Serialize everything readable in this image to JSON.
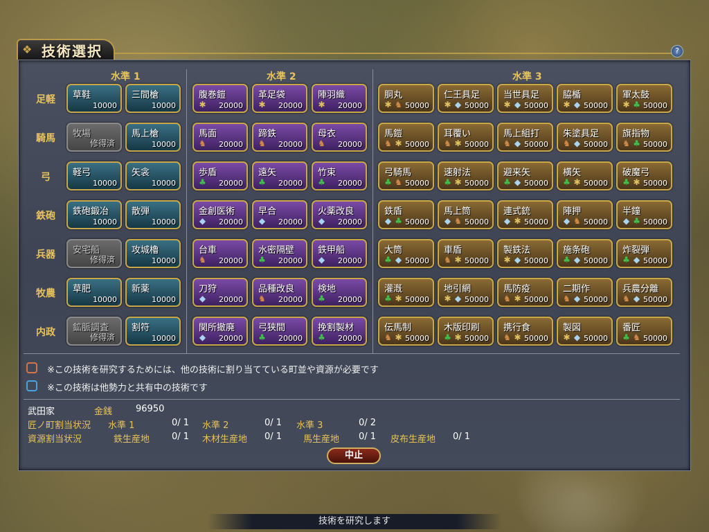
{
  "title": "技術選択",
  "help_label": "?",
  "levels": [
    "水準 1",
    "水準 2",
    "水準 3"
  ],
  "rows": [
    "足軽",
    "騎馬",
    "弓",
    "鉄砲",
    "兵器",
    "牧農",
    "内政"
  ],
  "lvl1": [
    [
      {
        "n": "草鞋",
        "c": "10000"
      },
      {
        "n": "三間槍",
        "c": "10000"
      }
    ],
    [
      {
        "n": "牧場",
        "c": "修得済",
        "g": true
      },
      {
        "n": "馬上槍",
        "c": "10000"
      }
    ],
    [
      {
        "n": "軽弓",
        "c": "10000"
      },
      {
        "n": "矢衾",
        "c": "10000"
      }
    ],
    [
      {
        "n": "鉄砲鍛冶",
        "c": "10000"
      },
      {
        "n": "散弾",
        "c": "10000"
      }
    ],
    [
      {
        "n": "安宅船",
        "c": "修得済",
        "g": true
      },
      {
        "n": "攻城櫓",
        "c": "10000"
      }
    ],
    [
      {
        "n": "草肥",
        "c": "10000"
      },
      {
        "n": "新薬",
        "c": "10000"
      }
    ],
    [
      {
        "n": "鉱脈調査",
        "c": "修得済",
        "g": true
      },
      {
        "n": "割符",
        "c": "10000"
      }
    ]
  ],
  "lvl2": [
    [
      {
        "n": "腹巻鎧",
        "c": "20000",
        "i": [
          "cloth"
        ]
      },
      {
        "n": "革足袋",
        "c": "20000",
        "i": [
          "cloth"
        ]
      },
      {
        "n": "陣羽織",
        "c": "20000",
        "i": [
          "cloth"
        ]
      }
    ],
    [
      {
        "n": "馬面",
        "c": "20000",
        "i": [
          "horse"
        ]
      },
      {
        "n": "蹄鉄",
        "c": "20000",
        "i": [
          "horse"
        ]
      },
      {
        "n": "母衣",
        "c": "20000",
        "i": [
          "horse"
        ]
      }
    ],
    [
      {
        "n": "歩盾",
        "c": "20000",
        "i": [
          "wood"
        ]
      },
      {
        "n": "遠矢",
        "c": "20000",
        "i": [
          "wood"
        ]
      },
      {
        "n": "竹束",
        "c": "20000",
        "i": [
          "wood"
        ]
      }
    ],
    [
      {
        "n": "金創医術",
        "c": "20000",
        "i": [
          "iron"
        ]
      },
      {
        "n": "早合",
        "c": "20000",
        "i": [
          "iron"
        ]
      },
      {
        "n": "火薬改良",
        "c": "20000",
        "i": [
          "iron"
        ]
      }
    ],
    [
      {
        "n": "台車",
        "c": "20000",
        "i": [
          "horse"
        ]
      },
      {
        "n": "水密隔壁",
        "c": "20000",
        "i": [
          "wood"
        ]
      },
      {
        "n": "鉄甲船",
        "c": "20000",
        "i": [
          "iron"
        ]
      }
    ],
    [
      {
        "n": "刀狩",
        "c": "20000",
        "i": [
          "iron"
        ]
      },
      {
        "n": "品種改良",
        "c": "20000",
        "i": [
          "horse"
        ]
      },
      {
        "n": "検地",
        "c": "20000",
        "i": [
          "wood"
        ]
      }
    ],
    [
      {
        "n": "関所撤廃",
        "c": "20000",
        "i": [
          "iron"
        ]
      },
      {
        "n": "弓狭間",
        "c": "20000",
        "i": [
          "wood"
        ]
      },
      {
        "n": "挽割製材",
        "c": "20000",
        "i": [
          "wood"
        ]
      }
    ]
  ],
  "lvl3": [
    [
      {
        "n": "胴丸",
        "c": "50000",
        "i": [
          "cloth",
          "horse"
        ]
      },
      {
        "n": "仁王具足",
        "c": "50000",
        "i": [
          "cloth",
          "iron"
        ]
      },
      {
        "n": "当世具足",
        "c": "50000",
        "i": [
          "cloth",
          "iron"
        ]
      },
      {
        "n": "脇楯",
        "c": "50000",
        "i": [
          "cloth",
          "iron"
        ]
      },
      {
        "n": "軍太鼓",
        "c": "50000",
        "i": [
          "cloth",
          "wood"
        ]
      }
    ],
    [
      {
        "n": "馬鎧",
        "c": "50000",
        "i": [
          "horse",
          "cloth"
        ]
      },
      {
        "n": "耳覆い",
        "c": "50000",
        "i": [
          "horse",
          "cloth"
        ]
      },
      {
        "n": "馬上組打",
        "c": "50000",
        "i": [
          "horse",
          "iron"
        ]
      },
      {
        "n": "朱塗具足",
        "c": "50000",
        "i": [
          "horse",
          "iron"
        ]
      },
      {
        "n": "旗指物",
        "c": "50000",
        "i": [
          "horse",
          "wood"
        ]
      }
    ],
    [
      {
        "n": "弓騎馬",
        "c": "50000",
        "i": [
          "wood",
          "horse"
        ]
      },
      {
        "n": "速射法",
        "c": "50000",
        "i": [
          "wood",
          "cloth"
        ]
      },
      {
        "n": "避来矢",
        "c": "50000",
        "i": [
          "wood",
          "iron"
        ]
      },
      {
        "n": "横矢",
        "c": "50000",
        "i": [
          "wood",
          "cloth"
        ]
      },
      {
        "n": "破魔弓",
        "c": "50000",
        "i": [
          "wood",
          "cloth"
        ]
      }
    ],
    [
      {
        "n": "鉄盾",
        "c": "50000",
        "i": [
          "iron",
          "wood"
        ]
      },
      {
        "n": "馬上筒",
        "c": "50000",
        "i": [
          "iron",
          "horse"
        ]
      },
      {
        "n": "連式銃",
        "c": "50000",
        "i": [
          "iron",
          "cloth"
        ]
      },
      {
        "n": "陣押",
        "c": "50000",
        "i": [
          "iron",
          "horse"
        ]
      },
      {
        "n": "半鐘",
        "c": "50000",
        "i": [
          "iron",
          "wood"
        ]
      }
    ],
    [
      {
        "n": "大筒",
        "c": "50000",
        "i": [
          "wood",
          "iron"
        ]
      },
      {
        "n": "車盾",
        "c": "50000",
        "i": [
          "horse",
          "cloth"
        ]
      },
      {
        "n": "製鉄法",
        "c": "50000",
        "i": [
          "cloth",
          "iron"
        ]
      },
      {
        "n": "施条砲",
        "c": "50000",
        "i": [
          "wood",
          "iron"
        ]
      },
      {
        "n": "炸裂弾",
        "c": "50000",
        "i": [
          "wood",
          "iron"
        ]
      }
    ],
    [
      {
        "n": "灌漑",
        "c": "50000",
        "i": [
          "wood",
          "cloth"
        ]
      },
      {
        "n": "地引網",
        "c": "50000",
        "i": [
          "cloth",
          "iron"
        ]
      },
      {
        "n": "馬防疫",
        "c": "50000",
        "i": [
          "horse",
          "cloth"
        ]
      },
      {
        "n": "二期作",
        "c": "50000",
        "i": [
          "horse",
          "iron"
        ]
      },
      {
        "n": "兵農分離",
        "c": "50000",
        "i": [
          "horse",
          "iron"
        ]
      }
    ],
    [
      {
        "n": "伝馬制",
        "c": "50000",
        "i": [
          "horse",
          "cloth"
        ]
      },
      {
        "n": "木版印刷",
        "c": "50000",
        "i": [
          "wood",
          "cloth"
        ]
      },
      {
        "n": "携行食",
        "c": "50000",
        "i": [
          "horse",
          "cloth"
        ]
      },
      {
        "n": "製図",
        "c": "50000",
        "i": [
          "cloth",
          "iron"
        ]
      },
      {
        "n": "番匠",
        "c": "50000",
        "i": [
          "wood",
          "horse"
        ]
      }
    ]
  ],
  "legend": {
    "orange_color": "#d9734a",
    "blue_color": "#4aa3e0",
    "orange_text": "※この技術を研究するためには、他の技術に割り当てている町並や資源が必要です",
    "blue_text": "※この技術は他勢力と共有中の技術です"
  },
  "status": {
    "clan": "武田家",
    "money_label": "金銭",
    "money": "96950",
    "town_label": "匠ノ町割当状況",
    "town_items": [
      {
        "label": "水準 1",
        "value": "0/ 1"
      },
      {
        "label": "水準 2",
        "value": "0/ 1"
      },
      {
        "label": "水準 3",
        "value": "0/ 2"
      }
    ],
    "res_label": "資源割当状況",
    "res_items": [
      {
        "label": "鉄生産地",
        "value": "0/ 1"
      },
      {
        "label": "木材生産地",
        "value": "0/ 1"
      },
      {
        "label": "馬生産地",
        "value": "0/ 1"
      },
      {
        "label": "皮布生産地",
        "value": "0/ 1"
      }
    ]
  },
  "stop_button": "中止",
  "status_bar": "技術を研究します"
}
